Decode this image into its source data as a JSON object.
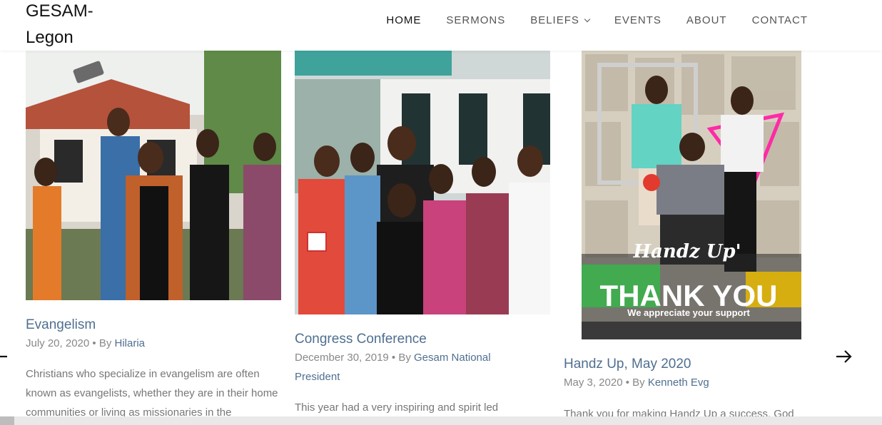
{
  "site": {
    "logo": "GESAM-\nLegon"
  },
  "nav": {
    "items": [
      {
        "label": "HOME"
      },
      {
        "label": "SERMONS"
      },
      {
        "label": "BELIEFS"
      },
      {
        "label": "EVENTS"
      },
      {
        "label": "ABOUT"
      },
      {
        "label": "CONTACT"
      }
    ]
  },
  "posts": [
    {
      "title": "Evangelism",
      "date": "July 20, 2020",
      "by": " • By ",
      "author": "Hilaria",
      "excerpt": "Christians who specialize in evangelism are often known as evangelists, whether they are in their home communities or living as missionaries in the"
    },
    {
      "title": "Congress Conference",
      "date": "December 30, 2019",
      "by": " • By ",
      "author": "Gesam National President",
      "excerpt": "This year had a very inspiring and spirit led"
    },
    {
      "title": "Handz Up, May 2020",
      "date": "May 3, 2020",
      "by": " • By ",
      "author": "Kenneth Evg",
      "excerpt": "Thank you for making Handz Up a success. God",
      "poster": {
        "brand": "Handz Up'",
        "headline": "THANK YOU",
        "tagline": "We appreciate your support"
      }
    }
  ],
  "icons": {
    "prev": "arrow-left-icon",
    "next": "arrow-right-icon"
  }
}
